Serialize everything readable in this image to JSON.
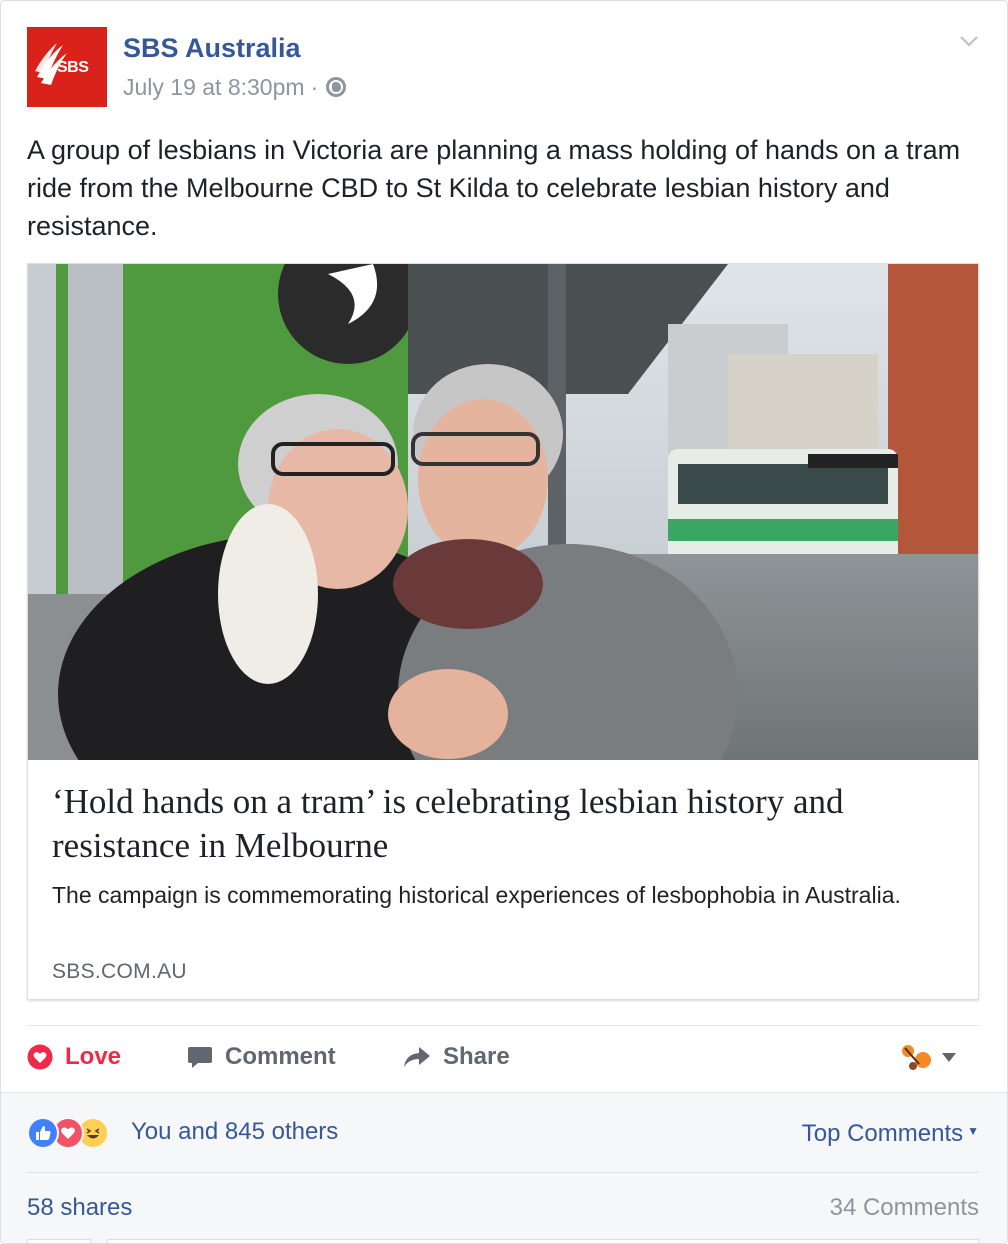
{
  "header": {
    "page_name": "SBS Australia",
    "logo_text": "SBS",
    "timestamp": "July 19 at 8:30pm",
    "separator": "·",
    "privacy_icon": "globe-icon",
    "menu_icon": "chevron-down-icon"
  },
  "post": {
    "text": "A group of lesbians in Victoria are planning a mass holding of hands on a tram ride from the Melbourne CBD to St Kilda to celebrate lesbian history and resistance."
  },
  "link": {
    "title": "‘Hold hands on a tram’ is celebrating lesbian history and resistance in Melbourne",
    "description": "The campaign is commemorating historical experiences of lesbophobia in Australia.",
    "domain": "SBS.COM.AU"
  },
  "actions": {
    "love_label": "Love",
    "comment_label": "Comment",
    "share_label": "Share"
  },
  "footer": {
    "reaction_icons": [
      "like-icon",
      "love-icon",
      "haha-icon"
    ],
    "reaction_summary": "You and 845 others",
    "sort_label": "Top Comments",
    "shares": "58 shares",
    "comments": "34 Comments"
  },
  "colors": {
    "brand_red": "#d9221a",
    "link_blue": "#365899",
    "love_red": "#f0284a",
    "muted_gray": "#90949c"
  }
}
